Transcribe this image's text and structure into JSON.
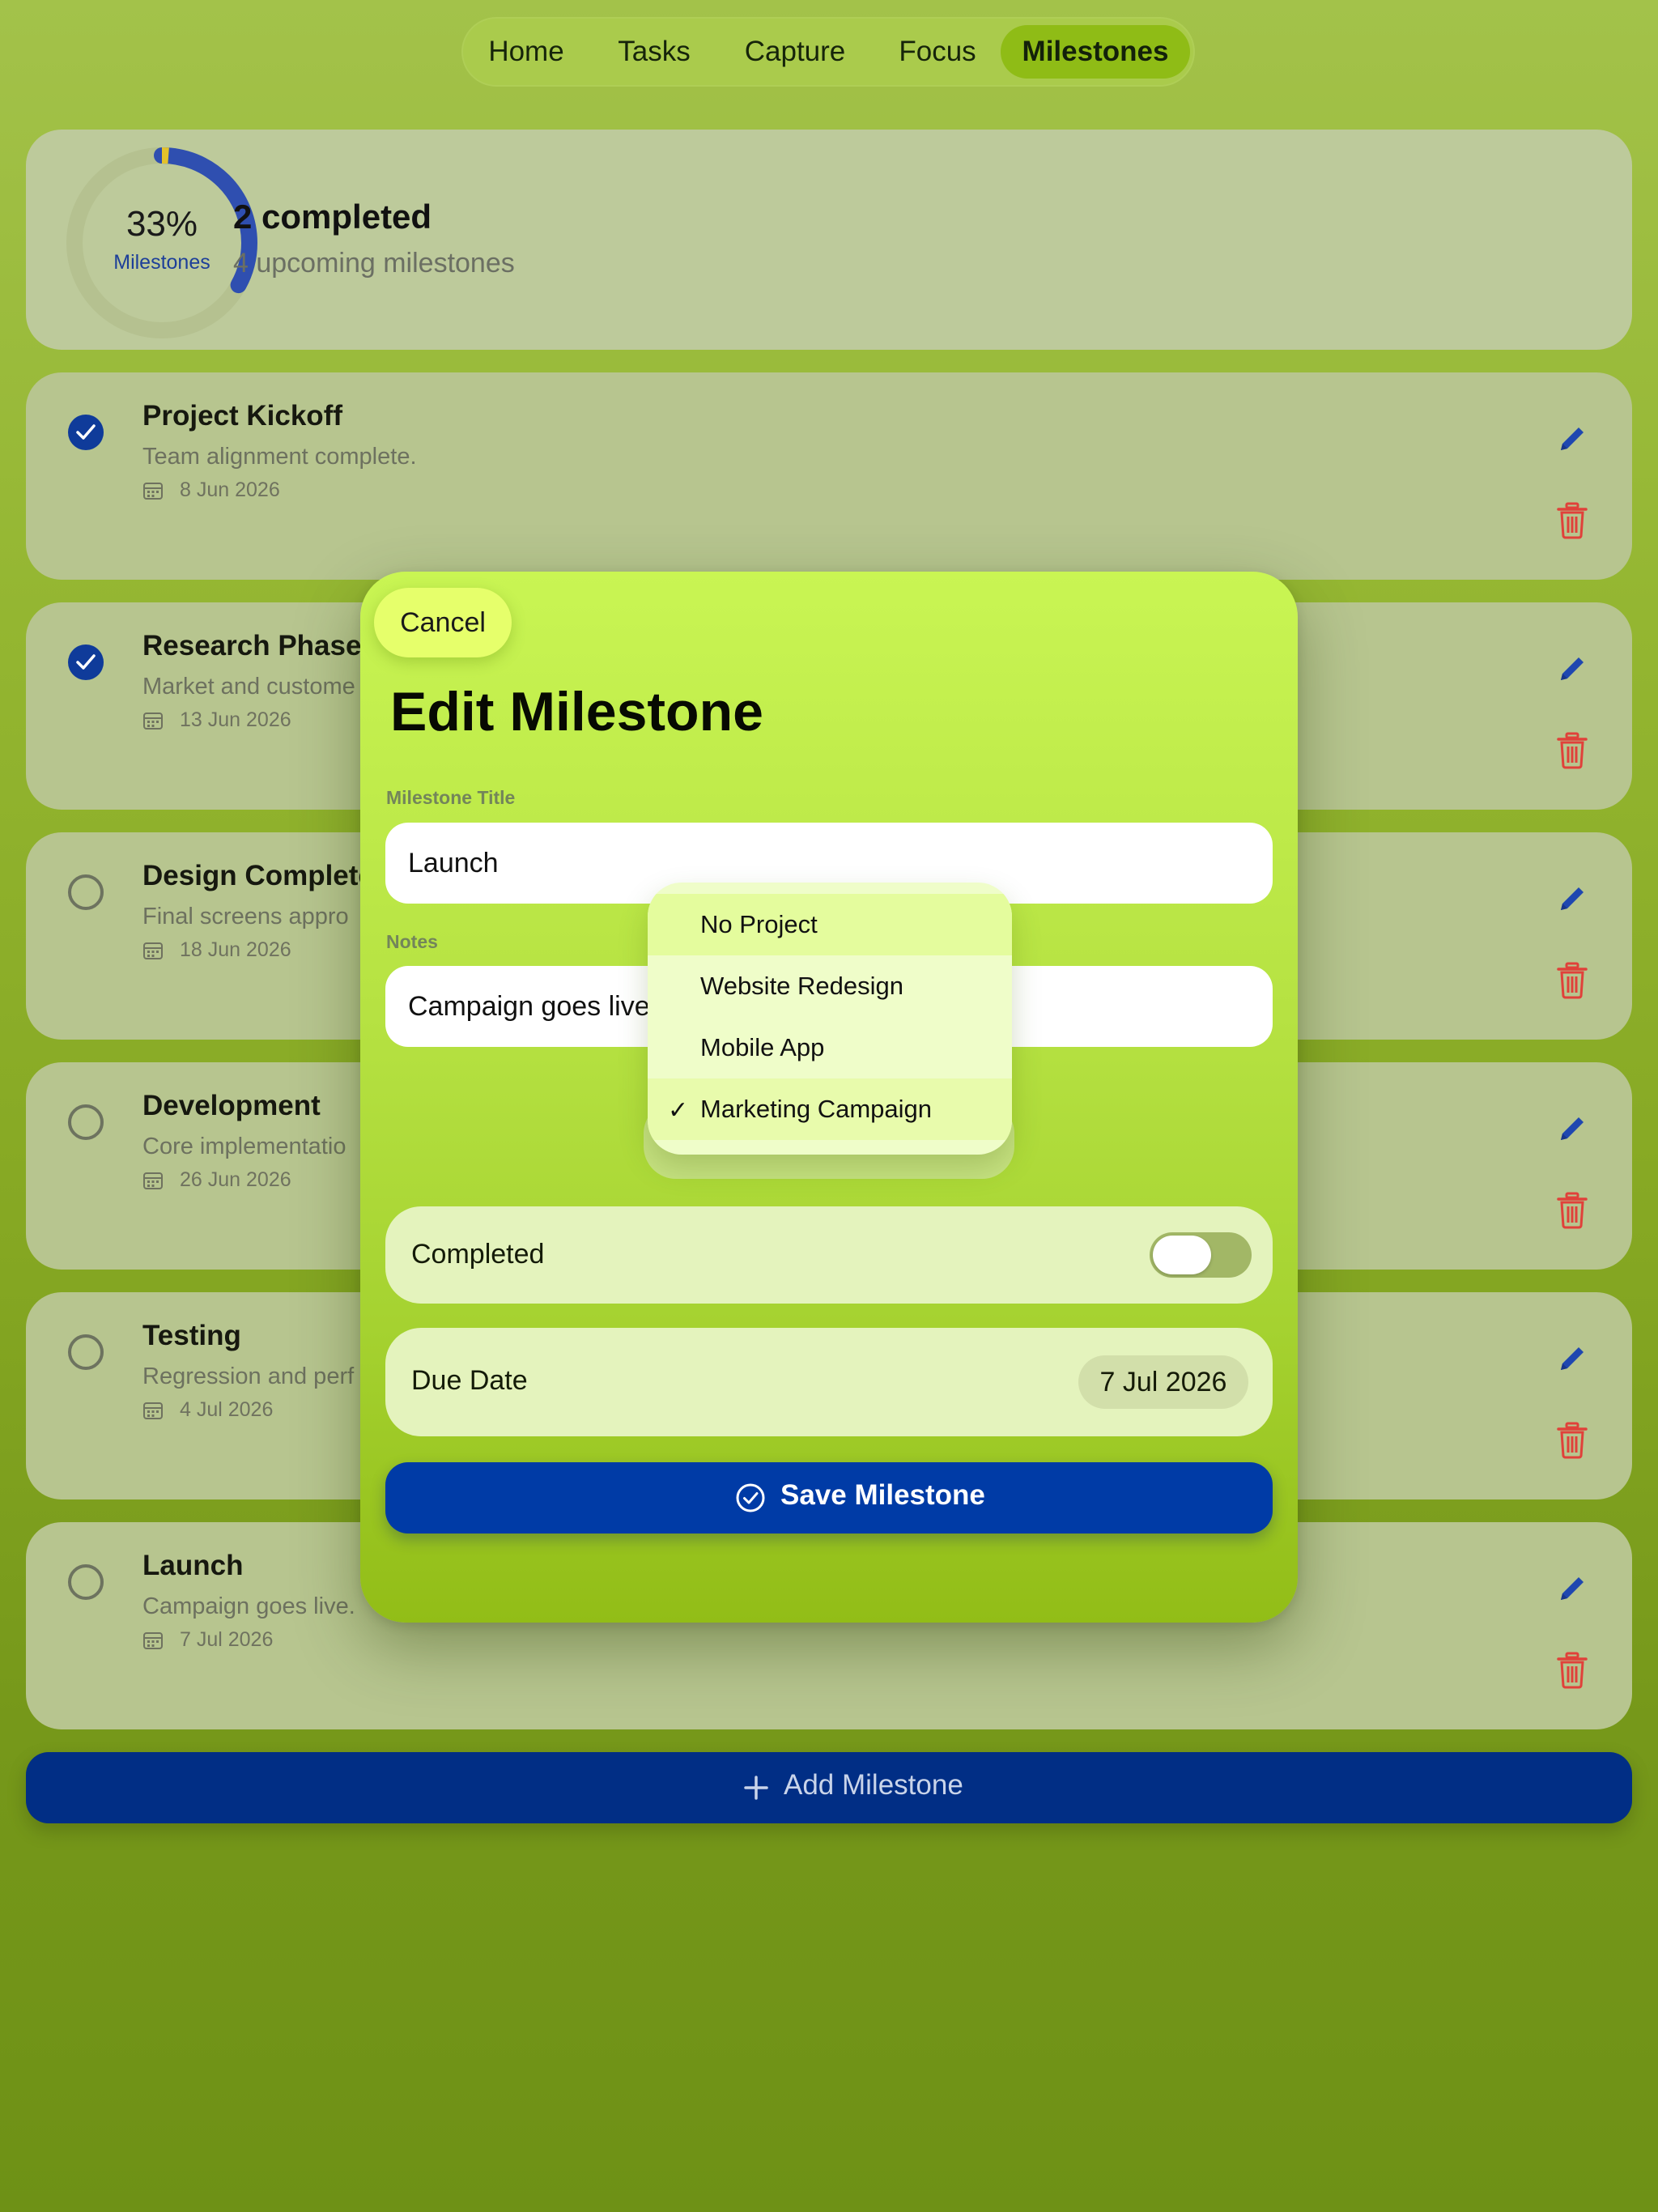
{
  "nav": {
    "items": [
      "Home",
      "Tasks",
      "Capture",
      "Focus",
      "Milestones"
    ],
    "active": "Milestones"
  },
  "summary": {
    "percent_text": "33%",
    "ring_label": "Milestones",
    "progress_fraction": 0.33,
    "completed_text": "2 completed",
    "upcoming_text": "4 upcoming milestones"
  },
  "milestones": [
    {
      "title": "Project Kickoff",
      "notes": "Team alignment complete.",
      "date": "8 Jun 2026",
      "completed": true
    },
    {
      "title": "Research Phase",
      "notes": "Market and custome",
      "date": "13 Jun 2026",
      "completed": true
    },
    {
      "title": "Design Complete",
      "notes": "Final screens appro",
      "date": "18 Jun 2026",
      "completed": false
    },
    {
      "title": "Development",
      "notes": "Core implementatio",
      "date": "26 Jun 2026",
      "completed": false
    },
    {
      "title": "Testing",
      "notes": "Regression and perf",
      "date": "4 Jul 2026",
      "completed": false
    },
    {
      "title": "Launch",
      "notes": "Campaign goes live.",
      "date": "7 Jul 2026",
      "completed": false
    }
  ],
  "add_button": {
    "label": "Add Milestone"
  },
  "modal": {
    "cancel_label": "Cancel",
    "title": "Edit Milestone",
    "title_field_label": "Milestone Title",
    "title_value": "Launch",
    "notes_field_label": "Notes",
    "notes_value": "Campaign goes live",
    "completed_label": "Completed",
    "completed_on": false,
    "due_date_label": "Due Date",
    "due_date_value": "7 Jul 2026",
    "save_label": "Save Milestone"
  },
  "project_menu": {
    "options": [
      "No Project",
      "Website Redesign",
      "Mobile App",
      "Marketing Campaign"
    ],
    "selected": "Marketing Campaign",
    "check_glyph": "✓"
  },
  "colors": {
    "accent_blue": "#003ba6",
    "delete_red": "#e0413a",
    "modal_lime": "#c9f553",
    "ring_progress": "#2f4fb0",
    "ring_start": "#e3c22b"
  },
  "icons": {
    "completed_check": "check-circle-icon",
    "todo": "empty-circle-icon",
    "date": "calendar-icon",
    "edit": "pencil-icon",
    "delete": "trash-icon",
    "add": "plus-icon",
    "save": "check-circle-icon"
  }
}
